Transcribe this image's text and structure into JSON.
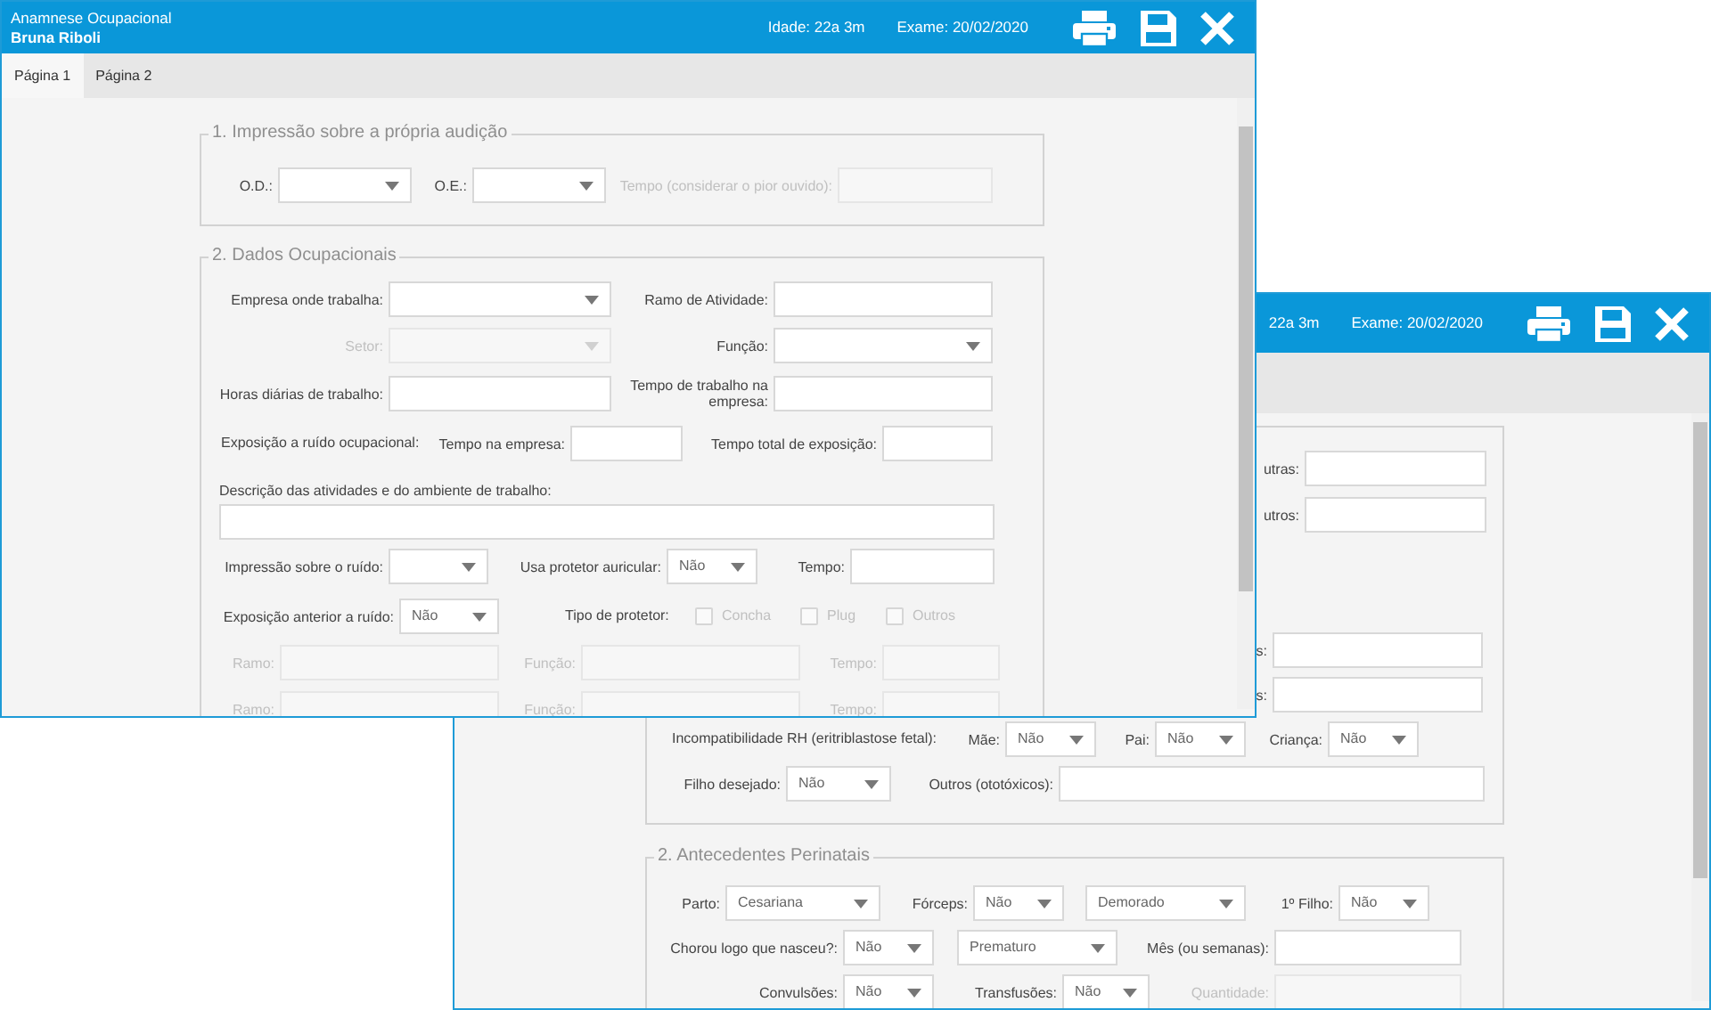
{
  "windows": [
    {
      "header": {
        "title": "Anamnese Ocupacional",
        "patient": "Bruna Riboli",
        "age": "Idade: 22a 3m",
        "exam": "Exame: 20/02/2020"
      },
      "tabs": [
        {
          "label": "Página 1",
          "selected": true
        },
        {
          "label": "Página 2",
          "selected": false
        }
      ],
      "sections": [
        {
          "legend": "1. Impressão sobre a própria audição",
          "rows": [
            [
              {
                "kind": "select",
                "label": "O.D.:",
                "disabled": false
              },
              {
                "kind": "select",
                "label": "O.E.:",
                "disabled": false
              },
              {
                "kind": "field",
                "label": "Tempo (considerar o pior ouvido):",
                "disabled": true
              }
            ]
          ]
        },
        {
          "legend": "2. Dados Ocupacionais",
          "rows": [
            [
              {
                "kind": "select",
                "label": "Empresa onde trabalha:",
                "disabled": false
              },
              {
                "kind": "field",
                "label": "Ramo de Atividade:",
                "disabled": false
              }
            ],
            [
              {
                "kind": "select",
                "label": "Setor:",
                "disabled": true
              },
              {
                "kind": "select",
                "label": "Função:",
                "disabled": false
              }
            ],
            [
              {
                "kind": "field",
                "label": "Horas diárias de trabalho:",
                "disabled": false
              },
              {
                "kind": "field",
                "label": "Tempo de trabalho na empresa:",
                "disabled": false
              }
            ],
            [
              {
                "kind": "text",
                "text": "Exposição a ruído ocupacional:"
              },
              {
                "kind": "field",
                "label": "Tempo na empresa:",
                "disabled": false
              },
              {
                "kind": "field",
                "label": "Tempo total de exposição:",
                "disabled": false
              }
            ],
            [
              {
                "kind": "textarea",
                "label": "Descrição das atividades e do ambiente de trabalho:",
                "disabled": false
              }
            ],
            [
              {
                "kind": "select",
                "label": "Impressão sobre o ruído:",
                "disabled": false
              },
              {
                "kind": "select",
                "label": "Usa protetor auricular:",
                "value": "Não",
                "disabled": false
              },
              {
                "kind": "field",
                "label": "Tempo:",
                "disabled": false
              }
            ],
            [
              {
                "kind": "select",
                "label": "Exposição anterior a ruído:",
                "value": "Não",
                "disabled": false
              },
              {
                "kind": "text",
                "text": "Tipo de protetor:"
              },
              {
                "kind": "checkbox",
                "label": "Concha",
                "checked": false,
                "disabled": true
              },
              {
                "kind": "checkbox",
                "label": "Plug",
                "checked": false,
                "disabled": true
              },
              {
                "kind": "checkbox",
                "label": "Outros",
                "checked": false,
                "disabled": true
              }
            ],
            [
              {
                "kind": "field",
                "label": "Ramo:",
                "disabled": true
              },
              {
                "kind": "field",
                "label": "Função:",
                "disabled": true
              },
              {
                "kind": "field",
                "label": "Tempo:",
                "disabled": true
              }
            ],
            [
              {
                "kind": "field",
                "label": "Ramo:",
                "disabled": true
              },
              {
                "kind": "field",
                "label": "Função:",
                "disabled": true
              },
              {
                "kind": "field",
                "label": "Tempo:",
                "disabled": true
              }
            ]
          ]
        }
      ]
    },
    {
      "header": {
        "age": "22a 3m",
        "exam": "Exame: 20/02/2020"
      },
      "sections": [
        {
          "rows": [
            [
              {
                "kind": "field",
                "label": "utras:",
                "disabled": false
              }
            ],
            [
              {
                "kind": "field",
                "label": "utros:",
                "disabled": false
              }
            ],
            [
              {
                "kind": "field",
                "label": "s:",
                "disabled": false
              }
            ],
            [
              {
                "kind": "field",
                "label": "s:",
                "disabled": false
              }
            ],
            [
              {
                "kind": "text",
                "text": "Incompatibilidade RH (eritriblastose fetal):"
              },
              {
                "kind": "select",
                "label": "Mãe:",
                "value": "Não",
                "disabled": false
              },
              {
                "kind": "select",
                "label": "Pai:",
                "value": "Não",
                "disabled": false
              },
              {
                "kind": "select",
                "label": "Criança:",
                "value": "Não",
                "disabled": false
              }
            ],
            [
              {
                "kind": "select",
                "label": "Filho desejado:",
                "value": "Não",
                "disabled": false
              },
              {
                "kind": "field",
                "label": "Outros (ototóxicos):",
                "disabled": false
              }
            ]
          ]
        },
        {
          "legend": "2. Antecedentes Perinatais",
          "rows": [
            [
              {
                "kind": "select",
                "label": "Parto:",
                "value": "Cesariana",
                "disabled": false
              },
              {
                "kind": "select",
                "label": "Fórceps:",
                "value": "Não",
                "disabled": false
              },
              {
                "kind": "select",
                "value": "Demorado",
                "disabled": false
              },
              {
                "kind": "select",
                "label": "1º Filho:",
                "value": "Não",
                "disabled": false
              }
            ],
            [
              {
                "kind": "select",
                "label": "Chorou logo que nasceu?:",
                "value": "Não",
                "disabled": false
              },
              {
                "kind": "select",
                "value": "Prematuro",
                "disabled": false
              },
              {
                "kind": "field",
                "label": "Mês (ou semanas):",
                "disabled": false
              }
            ],
            [
              {
                "kind": "select",
                "label": "Convulsões:",
                "value": "Não",
                "disabled": false
              },
              {
                "kind": "select",
                "label": "Transfusões:",
                "value": "Não",
                "disabled": false
              },
              {
                "kind": "field",
                "label": "Quantidade:",
                "disabled": true
              }
            ]
          ]
        }
      ]
    }
  ]
}
